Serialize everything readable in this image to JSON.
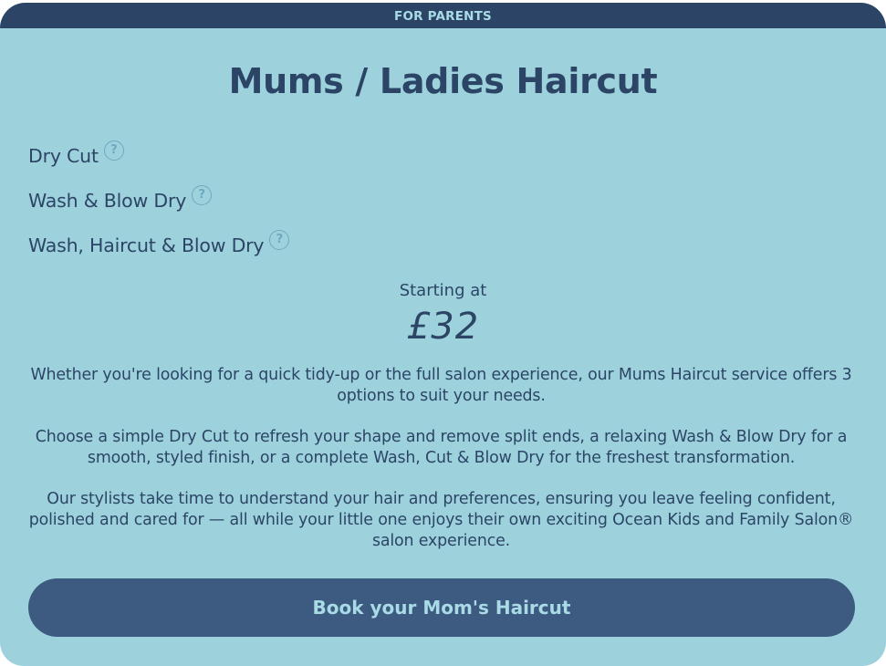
{
  "banner": {
    "label": "FOR PARENTS"
  },
  "service": {
    "title": "Mums / Ladies Haircut",
    "options": [
      {
        "label": "Dry Cut",
        "help_icon": "question-icon",
        "help_glyph": "?"
      },
      {
        "label": "Wash & Blow Dry",
        "help_icon": "question-icon",
        "help_glyph": "?"
      },
      {
        "label": "Wash, Haircut & Blow Dry",
        "help_icon": "question-icon",
        "help_glyph": "?"
      }
    ]
  },
  "pricing": {
    "starting_label": "Starting at",
    "price": "£32"
  },
  "description": {
    "paragraphs": [
      "Whether you're looking for a quick tidy-up or the full salon experience, our Mums Haircut service offers 3 options to suit your needs.",
      "Choose a simple Dry Cut to refresh your shape and remove split ends, a relaxing Wash & Blow Dry for a smooth, styled finish, or a complete Wash, Cut & Blow Dry for the freshest transformation.",
      "Our stylists take time to understand your hair and preferences, ensuring you leave feeling confident, polished and cared for — all while your little one enjoys their own exciting Ocean Kids and Family Salon® salon experience."
    ]
  },
  "cta": {
    "label": "Book your Mom's Haircut"
  },
  "colors": {
    "card_background": "#9dd2dd",
    "banner_background": "#2c4566",
    "text_primary": "#2c4566",
    "button_background": "#3d5a80",
    "button_text": "#a8dbe6",
    "help_icon": "#6fa9bd"
  }
}
